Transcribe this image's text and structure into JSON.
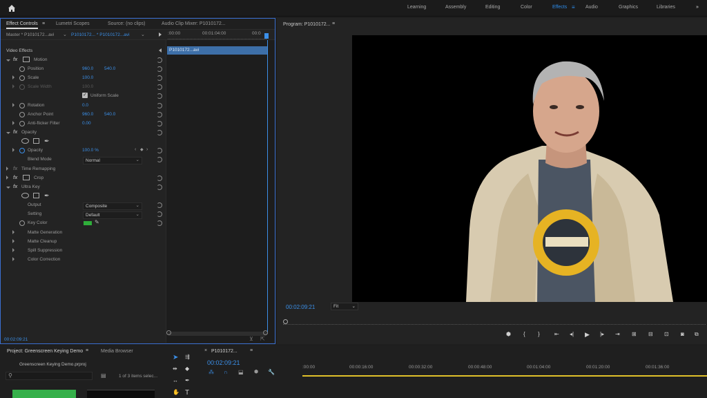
{
  "topbar": {
    "workspaces": [
      "Learning",
      "Assembly",
      "Editing",
      "Color",
      "Effects",
      "Audio",
      "Graphics",
      "Libraries"
    ],
    "active": "Effects",
    "more": "»"
  },
  "effect_controls": {
    "tabs": [
      "Effect Controls",
      "Lumetri Scopes",
      "Source: (no clips)",
      "Audio Clip Mixer: P1010172..."
    ],
    "master_label": "Master * P1010172...avi",
    "clip_label": "P1010172... * P1010172...avi",
    "timecodes": [
      ":00:00",
      "00:01:04:00",
      "00:0"
    ],
    "clip_bar": "P1010172...avi",
    "video_effects": "Video Effects",
    "motion": "Motion",
    "position": "Position",
    "position_x": "960.0",
    "position_y": "540.0",
    "scale": "Scale",
    "scale_val": "100.0",
    "scale_width": "Scale Width",
    "scale_width_val": "100.0",
    "uniform_scale": "Uniform Scale",
    "rotation": "Rotation",
    "rotation_val": "0.0",
    "anchor_point": "Anchor Point",
    "anchor_x": "960.0",
    "anchor_y": "540.0",
    "anti_flicker": "Anti-flicker Filter",
    "anti_flicker_val": "0.00",
    "opacity": "Opacity",
    "opacity_param": "Opacity",
    "opacity_val": "100.0 %",
    "blend_mode": "Blend Mode",
    "blend_mode_val": "Normal",
    "time_remapping": "Time Remapping",
    "crop": "Crop",
    "ultra_key": "Ultra Key",
    "output": "Output",
    "output_val": "Composite",
    "setting": "Setting",
    "setting_val": "Default",
    "key_color": "Key Color",
    "matte_generation": "Matte Generation",
    "matte_cleanup": "Matte Cleanup",
    "spill_suppression": "Spill Suppression",
    "color_correction": "Color Correction",
    "current_time": "00:02:09:21"
  },
  "program": {
    "title": "Program: P1010172...",
    "timecode": "00:02:09:21",
    "fit": "Fit"
  },
  "project": {
    "tabs": [
      "Project: Greenscreen Keying Demo",
      "Media Browser"
    ],
    "filename": "Greenscreen Keying Demo.prproj",
    "items": "1 of 3 items selec..."
  },
  "timeline": {
    "sequence": "P1010172...",
    "timecode": "00:02:09:21",
    "ruler": [
      ":00:00",
      "00:00:16:00",
      "00:00:32:00",
      "00:00:48:00",
      "00:01:04:00",
      "00:01:20:00",
      "00:01:36:00"
    ]
  },
  "colors": {
    "accent": "#2d8ceb",
    "key_color": "#2fae3a",
    "playhead": "#3b8fe8"
  }
}
